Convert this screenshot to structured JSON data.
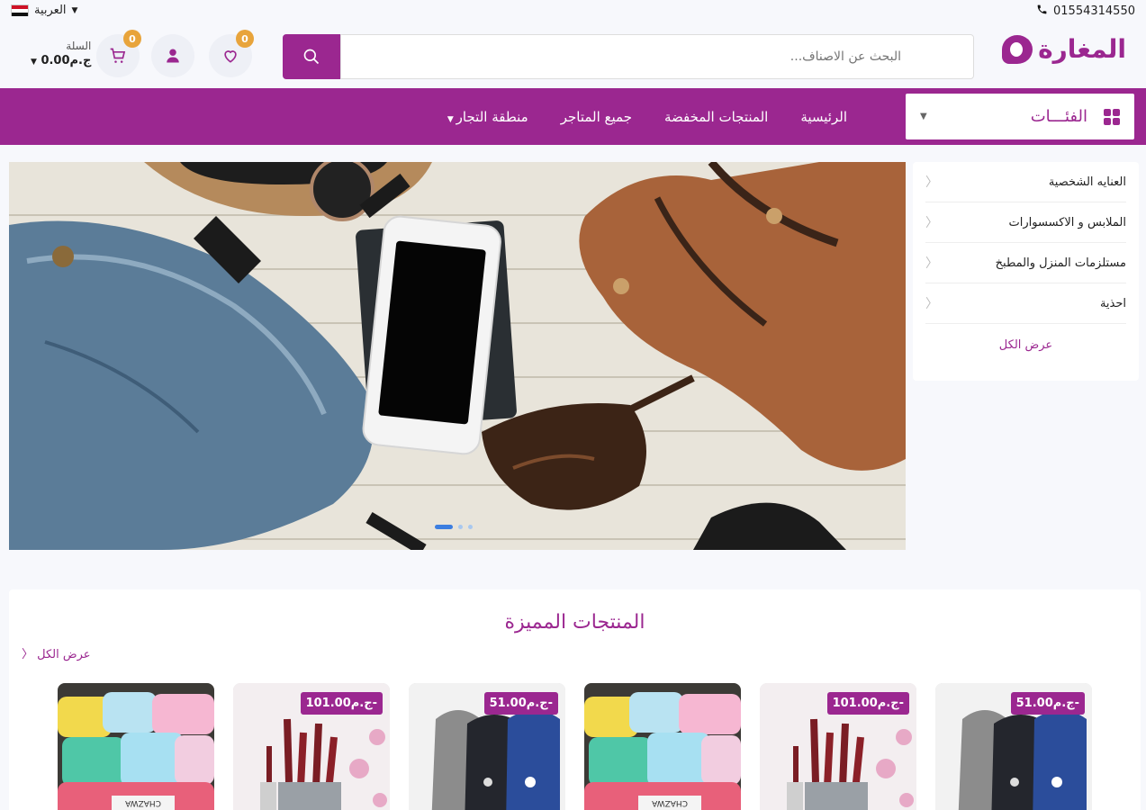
{
  "topbar": {
    "phone": "01554314550",
    "language": "العربية"
  },
  "header": {
    "logo_text": "المغارة",
    "search_placeholder": "البحث عن الاصناف...",
    "wishlist_count": "0",
    "cart_count": "0",
    "cart_label": "السلة",
    "cart_total": "0.00ج.م"
  },
  "nav": {
    "categories_label": "الفئـــات",
    "links": [
      "الرئيسية",
      "المنتجات المخفضة",
      "جميع المتاجر",
      "منطقة التجار"
    ]
  },
  "sidebar": {
    "items": [
      "العنايه الشخصية",
      "الملابس و الاكسسوارات",
      "مستلزمات المنزل والمطبخ",
      "احذية"
    ],
    "view_all": "عرض الكل"
  },
  "hero": {
    "slide_count": 3,
    "active_slide": 1
  },
  "featured": {
    "title": "المنتجات المميزة",
    "view_all": "عرض الكل",
    "products": [
      {
        "price": "",
        "image": "storage-containers"
      },
      {
        "price": "ج.م101.00-",
        "image": "knife-set"
      },
      {
        "price": "ج.م51.00-",
        "image": "slippers"
      },
      {
        "price": "",
        "image": "storage-containers"
      },
      {
        "price": "ج.م101.00-",
        "image": "knife-set"
      },
      {
        "price": "ج.م51.00-",
        "image": "slippers"
      }
    ]
  },
  "colors": {
    "brand": "#9b2790",
    "badge": "#e8a43b"
  }
}
